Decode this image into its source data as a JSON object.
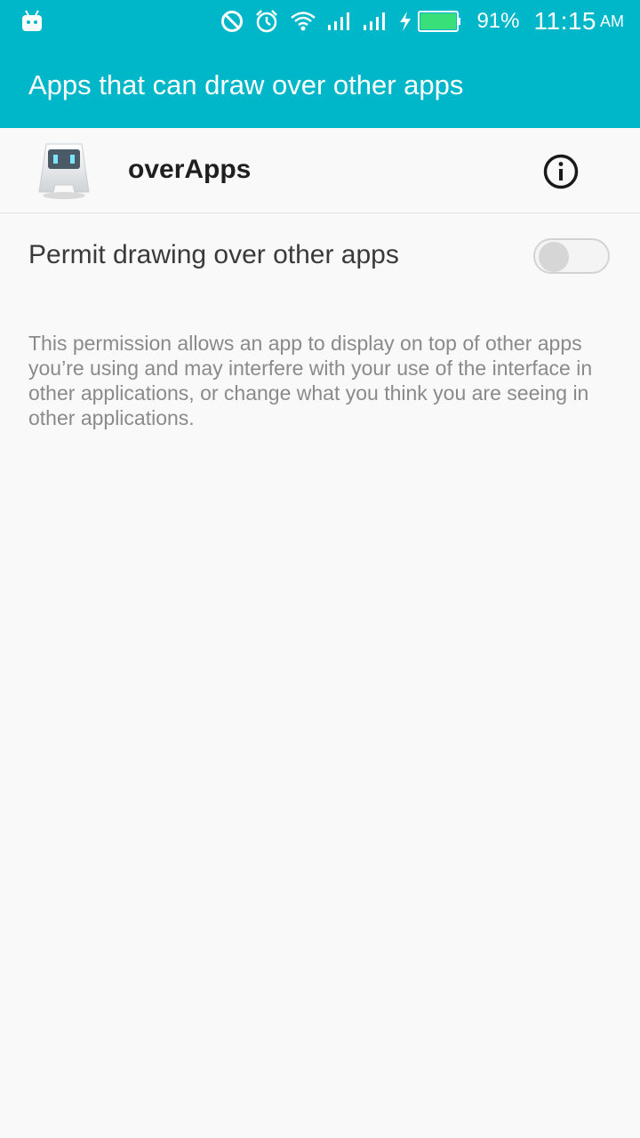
{
  "status_bar": {
    "battery_percent": "91%",
    "time": "11:15",
    "ampm": "AM",
    "icons": [
      "android-notification-icon",
      "do-not-disturb-icon",
      "alarm-icon",
      "wifi-icon",
      "signal-icon",
      "signal-icon",
      "charging-icon",
      "battery-icon"
    ]
  },
  "app_bar": {
    "title": "Apps that can draw over other apps"
  },
  "app": {
    "name": "overApps",
    "icon": "cordova-app-icon"
  },
  "permission": {
    "label": "Permit drawing over other apps",
    "enabled": false,
    "description": "This permission allows an app to display on top of other apps you’re using and may interfere with your use of the interface in other applications, or change what you think you are seeing in other applications."
  },
  "colors": {
    "accent": "#00b7c9",
    "background": "#f9f9f9",
    "battery": "#39e07a"
  }
}
